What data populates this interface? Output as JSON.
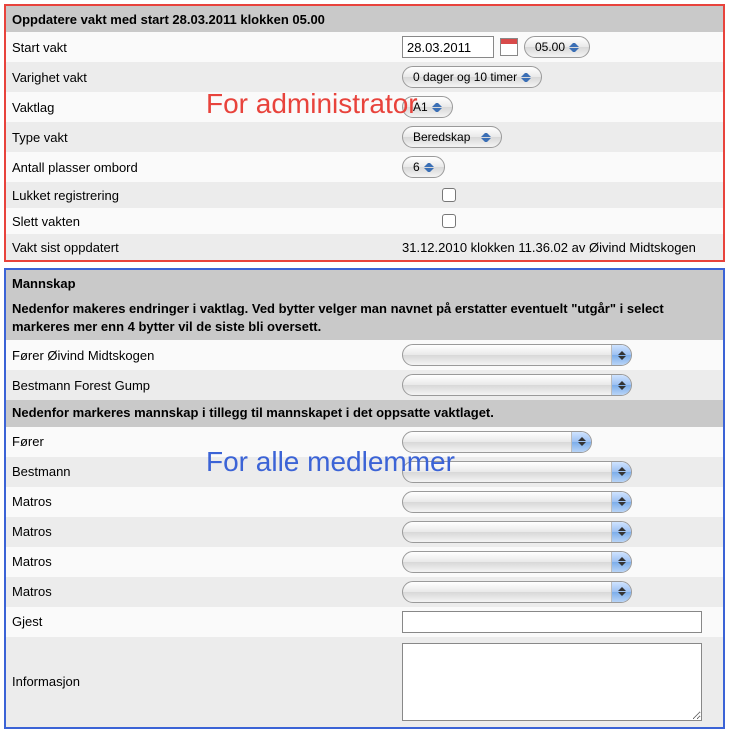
{
  "admin": {
    "header": "Oppdatere vakt med start 28.03.2011 klokken 05.00",
    "overlay": "For administrator",
    "rows": {
      "start_vakt_label": "Start vakt",
      "start_vakt_date": "28.03.2011",
      "start_vakt_time": "05.00",
      "varighet_label": "Varighet vakt",
      "varighet_value": "0 dager og 10 timer",
      "vaktlag_label": "Vaktlag",
      "vaktlag_value": "A1",
      "type_label": "Type vakt",
      "type_value": "Beredskap",
      "antall_label": "Antall plasser ombord",
      "antall_value": "6",
      "lukket_label": "Lukket registrering",
      "slett_label": "Slett vakten",
      "sist_label": "Vakt sist oppdatert",
      "sist_value": "31.12.2010 klokken 11.36.02 av Øivind Midtskogen"
    }
  },
  "member": {
    "overlay": "For alle medlemmer",
    "header": "Mannskap",
    "note": "Nedenfor makeres endringer i vaktlag. Ved bytter velger man navnet på erstatter eventuelt \"utgår\" i select markeres mer enn 4 bytter vil de siste bli oversett.",
    "crew_forer_label": "Fører Øivind Midtskogen",
    "crew_bestmann_label": "Bestmann Forest Gump",
    "extra_header": "Nedenfor markeres mannskap i tillegg til mannskapet i det oppsatte vaktlaget.",
    "extra": {
      "forer": "Fører",
      "bestmann": "Bestmann",
      "matros1": "Matros",
      "matros2": "Matros",
      "matros3": "Matros",
      "matros4": "Matros",
      "gjest": "Gjest",
      "informasjon": "Informasjon"
    }
  }
}
